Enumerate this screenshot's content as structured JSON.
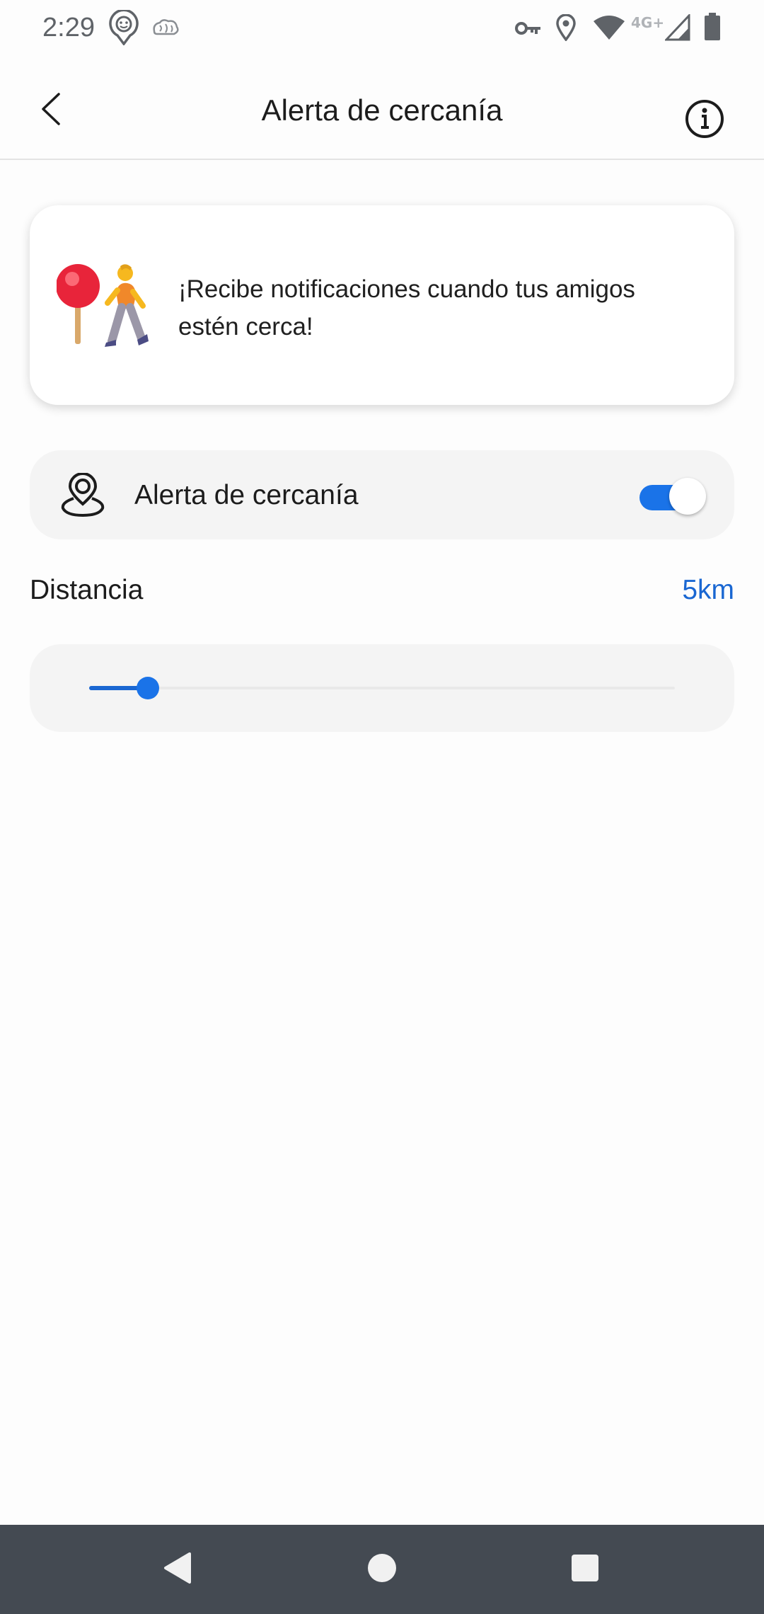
{
  "status_bar": {
    "time": "2:29",
    "network_label": "4G+",
    "icons": [
      "face-notification-icon",
      "brain-icon",
      "vpn-key-icon",
      "location-icon",
      "wifi-icon",
      "signal-icon",
      "battery-icon"
    ]
  },
  "header": {
    "title": "Alerta de cercanía",
    "back_icon": "back-arrow-icon",
    "info_icon": "info-icon"
  },
  "banner": {
    "text": "¡Recibe notificaciones cuando tus amigos estén cerca!",
    "illustration": "pin-and-walking-person"
  },
  "proximity_toggle": {
    "label": "Alerta de cercanía",
    "icon": "proximity-pin-icon",
    "enabled": true,
    "accent_color": "#1a73e8"
  },
  "distance": {
    "label": "Distancia",
    "value_text": "5km",
    "slider_fraction": 0.1,
    "accent_color": "#1a67d2"
  },
  "navigation_bar": {
    "buttons": [
      "back-triangle-icon",
      "home-circle-icon",
      "recents-square-icon"
    ]
  }
}
